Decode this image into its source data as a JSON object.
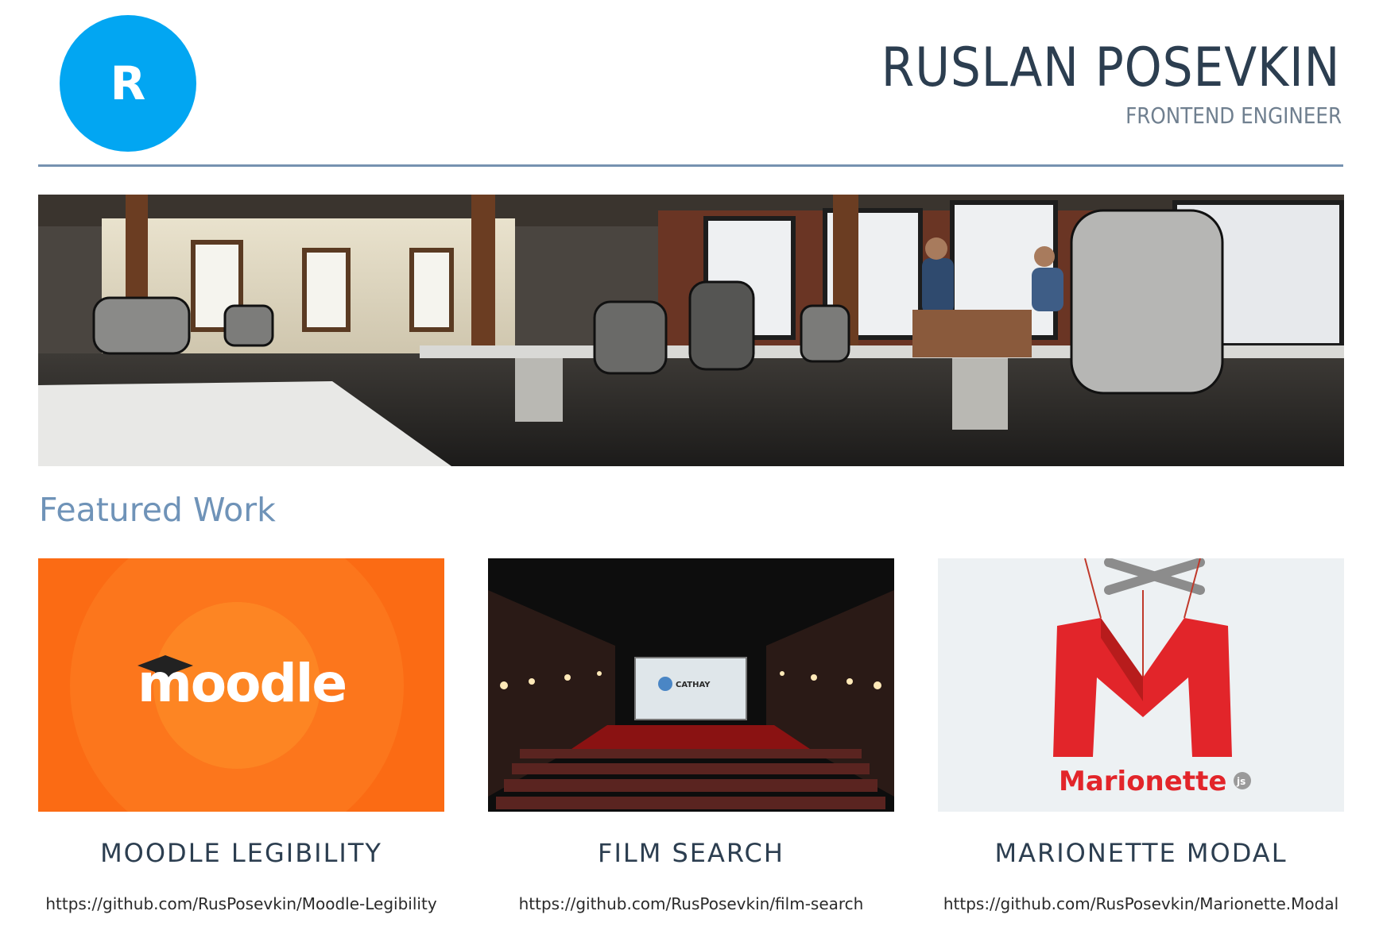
{
  "header": {
    "logo_letter": "R",
    "name": "RUSLAN POSEVKIN",
    "title": "FRONTEND ENGINEER"
  },
  "hero": {
    "image": "office-photo"
  },
  "featured": {
    "heading": "Featured Work",
    "projects": [
      {
        "title": "MOODLE LEGIBILITY",
        "link": "https://github.com/RusPosevkin/Moodle-Legibility",
        "thumb_text": "moodle",
        "thumb_color": "#fb6b14"
      },
      {
        "title": "FILM SEARCH",
        "link": "https://github.com/RusPosevkin/film-search",
        "thumb_text": "CATHAY",
        "thumb_color": "#0d0d0d"
      },
      {
        "title": "MARIONETTE MODAL",
        "link": "https://github.com/RusPosevkin/Marionette.Modal",
        "thumb_text": "Marionette",
        "thumb_badge": "js",
        "thumb_color": "#edf1f3"
      }
    ]
  },
  "colors": {
    "logo": "#02a6f2",
    "rule": "#7692b0",
    "heading": "#6f93b8",
    "moodle": "#fb6b14",
    "marionette_red": "#e2252a"
  }
}
